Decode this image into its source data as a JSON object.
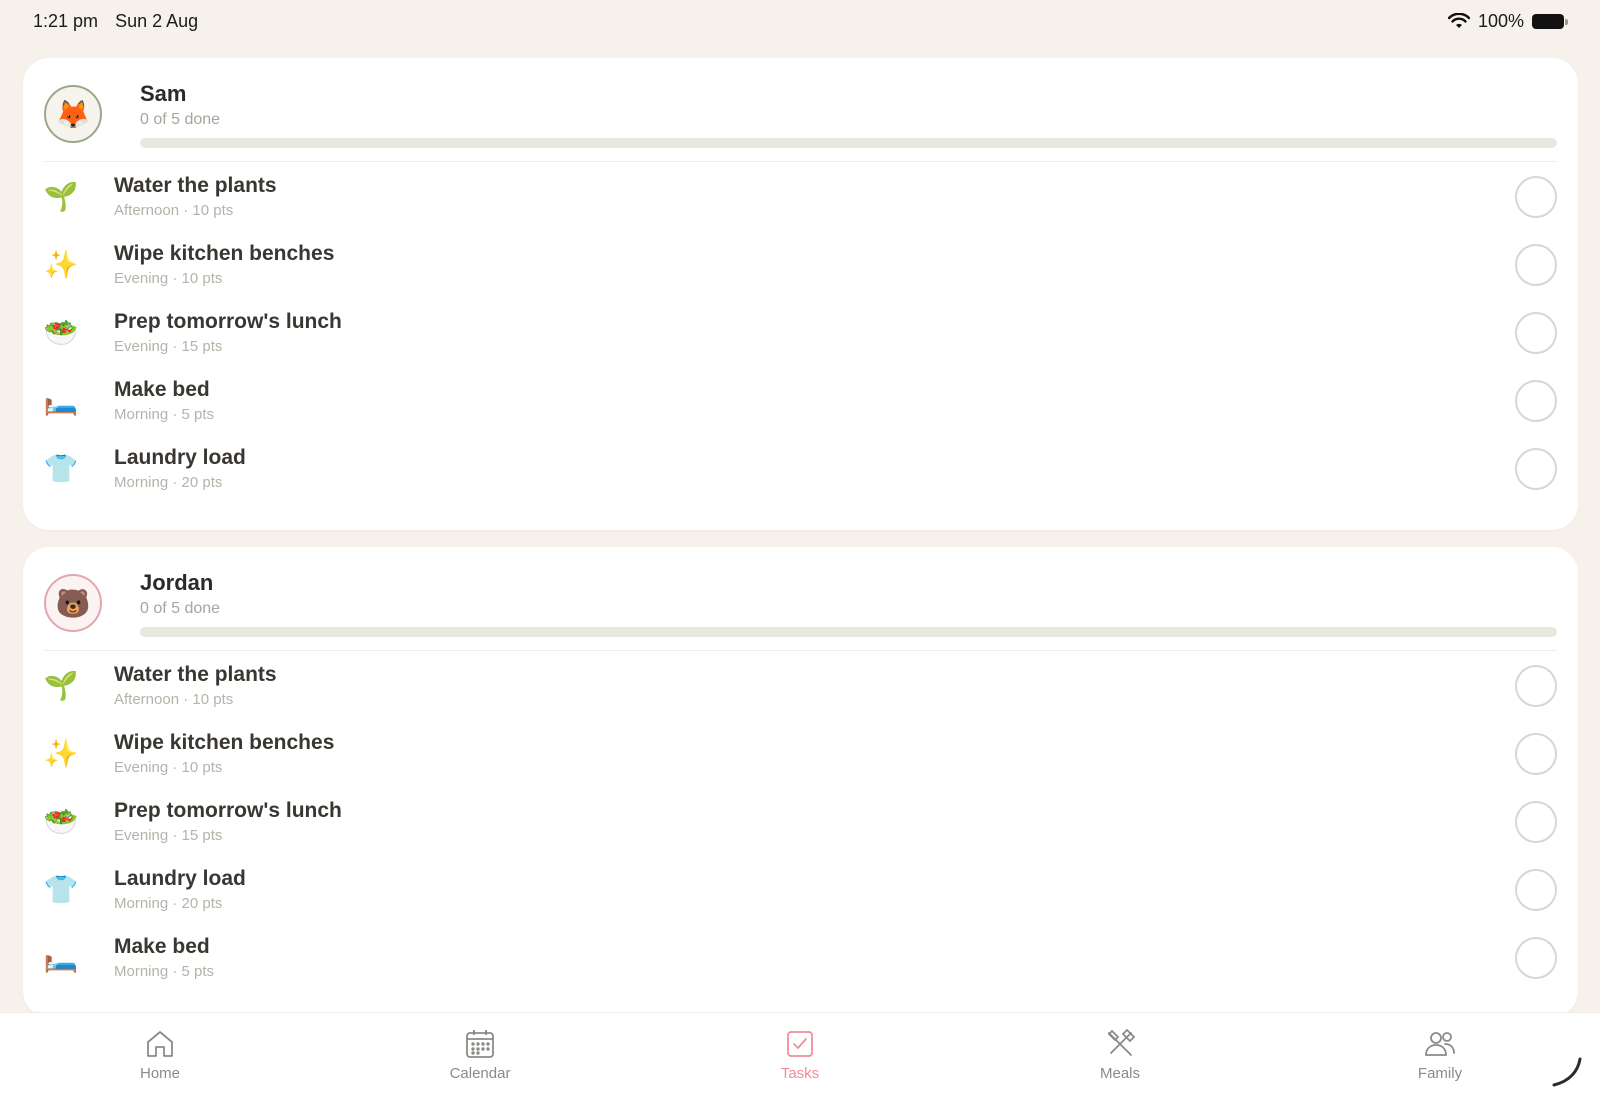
{
  "status_bar": {
    "time": "1:21 pm",
    "date": "Sun 2 Aug",
    "battery": "100%"
  },
  "members": [
    {
      "name": "Sam",
      "avatar_icon": "fox-icon",
      "avatar_emoji": "🦊",
      "progress_text": "0 of 5 done",
      "progress": 0,
      "tasks": [
        {
          "icon": "seedling-icon",
          "emoji": "🌱",
          "title": "Water the plants",
          "meta": "Afternoon · 10 pts"
        },
        {
          "icon": "sparkles-icon",
          "emoji": "✨",
          "title": "Wipe kitchen benches",
          "meta": "Evening · 10 pts"
        },
        {
          "icon": "salad-icon",
          "emoji": "🥗",
          "title": "Prep tomorrow's lunch",
          "meta": "Evening · 15 pts"
        },
        {
          "icon": "bed-icon",
          "emoji": "🛏️",
          "title": "Make bed",
          "meta": "Morning · 5 pts"
        },
        {
          "icon": "shirt-icon",
          "emoji": "👕",
          "title": "Laundry load",
          "meta": "Morning · 20 pts"
        }
      ]
    },
    {
      "name": "Jordan",
      "avatar_icon": "bear-icon",
      "avatar_emoji": "🐻",
      "progress_text": "0 of 5 done",
      "progress": 0,
      "tasks": [
        {
          "icon": "seedling-icon",
          "emoji": "🌱",
          "title": "Water the plants",
          "meta": "Afternoon · 10 pts"
        },
        {
          "icon": "sparkles-icon",
          "emoji": "✨",
          "title": "Wipe kitchen benches",
          "meta": "Evening · 10 pts"
        },
        {
          "icon": "salad-icon",
          "emoji": "🥗",
          "title": "Prep tomorrow's lunch",
          "meta": "Evening · 15 pts"
        },
        {
          "icon": "shirt-icon",
          "emoji": "👕",
          "title": "Laundry load",
          "meta": "Morning · 20 pts"
        },
        {
          "icon": "bed-icon",
          "emoji": "🛏️",
          "title": "Make bed",
          "meta": "Morning · 5 pts"
        }
      ]
    }
  ],
  "tabs": [
    {
      "label": "Home",
      "icon": "home-icon",
      "active": false
    },
    {
      "label": "Calendar",
      "icon": "calendar-icon",
      "active": false
    },
    {
      "label": "Tasks",
      "icon": "tasks-checkbox-icon",
      "active": true
    },
    {
      "label": "Meals",
      "icon": "utensils-icon",
      "active": false
    },
    {
      "label": "Family",
      "icon": "family-icon",
      "active": false
    }
  ],
  "colors": {
    "background": "#f6f1ea",
    "accent_active_tab": "#ef8d9f",
    "progress_track": "#e6e9dd",
    "progress_fill": "#9aa88a"
  }
}
